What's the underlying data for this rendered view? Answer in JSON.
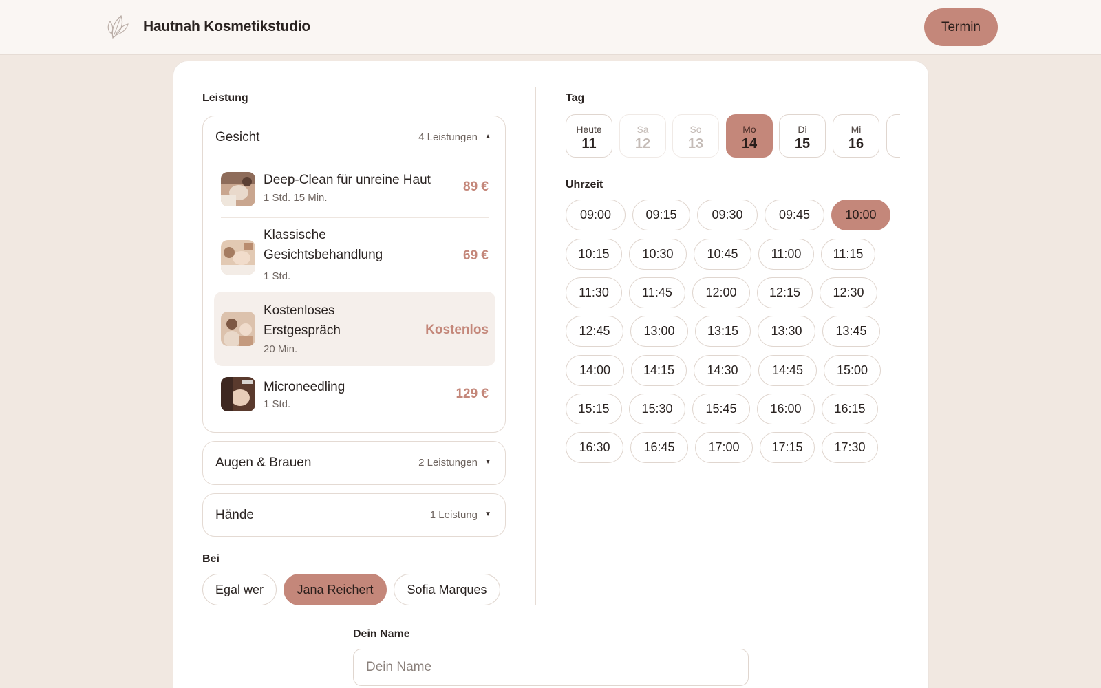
{
  "header": {
    "brand_name": "Hautnah Kosmetikstudio",
    "logo_icon": "leaf-icon",
    "cta_label": "Termin"
  },
  "colors": {
    "accent": "#c4877a",
    "background": "#f1e8e1",
    "header_bg": "#faf6f3",
    "selected_row_bg": "#f5efeb"
  },
  "leistung": {
    "label": "Leistung",
    "categories": [
      {
        "title": "Gesicht",
        "count": "4 Leistungen",
        "expanded": true,
        "caret": "▲",
        "services": [
          {
            "name": "Deep-Clean für unreine Haut",
            "duration": "1 Std. 15 Min.",
            "price": "89 €"
          },
          {
            "name": "Klassische Gesichtsbehandlung",
            "name_lines": [
              "Klassische",
              "Gesichtsbehandlung"
            ],
            "duration": "1 Std.",
            "price": "69 €"
          },
          {
            "name": "Kostenloses Erstgespräch",
            "name_lines": [
              "Kostenloses",
              "Erstgespräch"
            ],
            "duration": "20 Min.",
            "price": "Kostenlos",
            "selected": true
          },
          {
            "name": "Microneedling",
            "duration": "1 Std.",
            "price": "129 €"
          }
        ]
      },
      {
        "title": "Augen & Brauen",
        "count": "2 Leistungen",
        "expanded": false,
        "caret": "▼"
      },
      {
        "title": "Hände",
        "count": "1 Leistung",
        "expanded": false,
        "caret": "▼"
      }
    ]
  },
  "bei": {
    "label": "Bei",
    "options": [
      "Egal wer",
      "Jana Reichert",
      "Sofia Marques"
    ],
    "selected": "Jana Reichert"
  },
  "tag": {
    "label": "Tag",
    "days": [
      {
        "name": "Heute",
        "date": "11",
        "state": "normal"
      },
      {
        "name": "Sa",
        "date": "12",
        "state": "disabled"
      },
      {
        "name": "So",
        "date": "13",
        "state": "disabled"
      },
      {
        "name": "Mo",
        "date": "14",
        "state": "active"
      },
      {
        "name": "Di",
        "date": "15",
        "state": "normal"
      },
      {
        "name": "Mi",
        "date": "16",
        "state": "normal"
      }
    ]
  },
  "uhrzeit": {
    "label": "Uhrzeit",
    "selected": "10:00",
    "rows": [
      [
        "09:00",
        "09:15",
        "09:30",
        "09:45",
        "10:00"
      ],
      [
        "10:15",
        "10:30",
        "10:45",
        "11:00",
        "11:15"
      ],
      [
        "11:30",
        "11:45",
        "12:00",
        "12:15",
        "12:30"
      ],
      [
        "12:45",
        "13:00",
        "13:15",
        "13:30",
        "13:45"
      ],
      [
        "14:00",
        "14:15",
        "14:30",
        "14:45",
        "15:00"
      ],
      [
        "15:15",
        "15:30",
        "15:45",
        "16:00",
        "16:15"
      ],
      [
        "16:30",
        "16:45",
        "17:00",
        "17:15",
        "17:30"
      ]
    ]
  },
  "form": {
    "name_label": "Dein Name",
    "name_placeholder": "Dein Name",
    "name_value": ""
  }
}
